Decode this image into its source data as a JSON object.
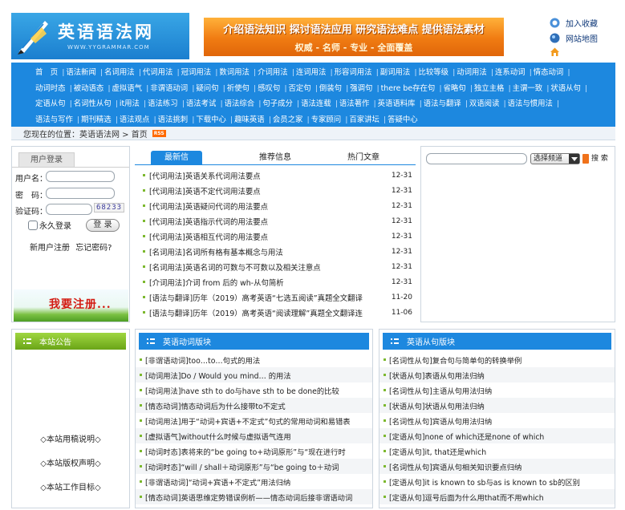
{
  "site": {
    "title": "英语语法网",
    "subtitle": "WWW.YYGRAMMAR.COM"
  },
  "banner": {
    "main": "介绍语法知识  探讨语法应用  研究语法难点  提供语法素材",
    "sub": "权威 - 名师 - 专业 - 全面覆盖"
  },
  "quick_links": [
    {
      "label": "加入收藏",
      "icon": "favorite-icon"
    },
    {
      "label": "网站地图",
      "icon": "sitemap-icon"
    },
    {
      "label": "",
      "icon": "home-icon"
    }
  ],
  "nav": [
    "首　页",
    "语法新闻",
    "名词用法",
    "代词用法",
    "冠词用法",
    "数词用法",
    "介词用法",
    "连词用法",
    "形容词用法",
    "副词用法",
    "比较等级",
    "动词用法",
    "连系动词",
    "情态动词",
    "动词时态",
    "被动语态",
    "虚拟语气",
    "非谓语动词",
    "疑问句",
    "祈使句",
    "感叹句",
    "否定句",
    "倒装句",
    "强调句",
    "there be存在句",
    "省略句",
    "独立主格",
    "主谓一致",
    "状语从句",
    "定语从句",
    "名词性从句",
    "it用法",
    "语法练习",
    "语法考试",
    "语法综合",
    "句子成分",
    "语法连载",
    "语法著作",
    "英语语料库",
    "语法与翻译",
    "双语阅读",
    "语法与惯用法",
    "语法与写作",
    "期刊精选",
    "语法观点",
    "语法挑刺",
    "下载中心",
    "趣味英语",
    "会员之家",
    "专家顾问",
    "百家讲坛",
    "答疑中心"
  ],
  "breadcrumb": {
    "label": "您现在的位置：",
    "path": "英语语法网 > 首页",
    "rss": "RSS"
  },
  "login": {
    "tab": "用户登录",
    "username_label": "用户名：",
    "password_label": "密　码：",
    "captcha_label": "验证码：",
    "captcha_value": "68233",
    "remember_label": "永久登录",
    "login_button": "登 录",
    "register_link": "新用户注册",
    "forgot_link": "忘记密码?",
    "register_banner": "我要注册..."
  },
  "news": {
    "tabs": [
      "最新信",
      "推荐信息",
      "热门文章"
    ],
    "items": [
      {
        "title": "[代词用法]英语关系代词用法要点",
        "date": "12-31"
      },
      {
        "title": "[代词用法]英语不定代词用法要点",
        "date": "12-31"
      },
      {
        "title": "[代词用法]英语疑问代词的用法要点",
        "date": "12-31"
      },
      {
        "title": "[代词用法]英语指示代词的用法要点",
        "date": "12-31"
      },
      {
        "title": "[代词用法]英语相互代词的用法要点",
        "date": "12-31"
      },
      {
        "title": "[名词用法]名词所有格有基本概念与用法",
        "date": "12-31"
      },
      {
        "title": "[名词用法]英语名词的可数与不可数以及相关注意点",
        "date": "12-31"
      },
      {
        "title": "[介词用法]介词 from 后的 wh-从句简析",
        "date": "12-31"
      },
      {
        "title": "[语法与翻译]历年（2019）高考英语“七选五阅读”真题全文翻译",
        "date": "11-20"
      },
      {
        "title": "[语法与翻译]历年（2019）高考英语“阅读理解”真题全文翻译连",
        "date": "11-06"
      }
    ]
  },
  "search": {
    "channel": "选择频道",
    "button": "搜 索"
  },
  "notice": {
    "title": "本站公告",
    "links": [
      "◇本站用稿说明◇",
      "◇本站版权声明◇",
      "◇本站工作目标◇"
    ]
  },
  "verbs": {
    "title": "英语动词版块",
    "items": [
      "[非谓语动词]too…to…句式的用法",
      "[动词用法]Do / Would you mind… 的用法",
      "[动词用法]have sth to do与have sth to be done的比较",
      "[情态动词]情态动词后为什么接带to不定式",
      "[动词用法]用于“动词+宾语+不定式”句式的常用动词和易错表",
      "[虚拟语气]without什么时候与虚拟语气连用",
      "[动词时态]表将来的“be going to+动词原形”与“现在进行时",
      "[动词时态]“will / shall＋动词原形”与“be going to＋动词",
      "[非谓语动词]“动词+宾语+不定式”用法归纳",
      "[情态动词]英语思维定势错误例析——情态动词后接非谓语动词"
    ]
  },
  "clauses": {
    "title": "英语从句版块",
    "items": [
      "[名词性从句]复合句与简单句的转换举例",
      "[状语从句]表语从句用法归纳",
      "[名词性从句]主语从句用法归纳",
      "[状语从句]状语从句用法归纳",
      "[名词性从句]宾语从句用法归纳",
      "[定语从句]none of which还是none of which",
      "[定语从句]it, that还是which",
      "[名词性从句]宾语从句相关知识要点归纳",
      "[定语从句]it is known to sb与as is known to sb的区别",
      "[定语从句]逗号后面为什么用that而不用which"
    ]
  }
}
